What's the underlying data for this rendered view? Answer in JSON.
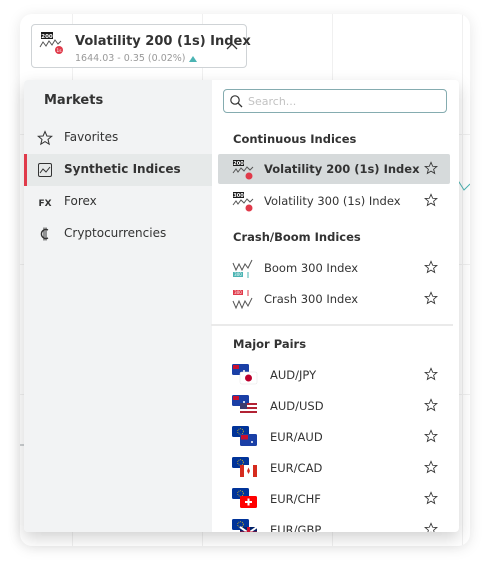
{
  "selector": {
    "symbol_label": "Volatility 200 (1s) Index",
    "price_text": "1644.03 - 0.35 (0.02%)",
    "change_direction": "up",
    "badge": "200",
    "expanded": true
  },
  "markets": {
    "title": "Markets",
    "categories": [
      {
        "label": "Favorites",
        "icon": "star-icon"
      },
      {
        "label": "Synthetic Indices",
        "icon": "synthetic-chart-icon",
        "active": true
      },
      {
        "label": "Forex",
        "icon": "fx-icon"
      },
      {
        "label": "Cryptocurrencies",
        "icon": "crypto-icon"
      }
    ]
  },
  "search": {
    "placeholder": "Search..."
  },
  "sections": [
    {
      "title": "Continuous Indices",
      "items": [
        {
          "label": "Volatility 200 (1s) Index",
          "badge": "200",
          "selected": true
        },
        {
          "label": "Volatility 300 (1s) Index",
          "badge": "300"
        }
      ]
    },
    {
      "title": "Crash/Boom Indices",
      "items": [
        {
          "label": "Boom 300 Index",
          "badge": "300"
        },
        {
          "label": "Crash 300 Index",
          "badge": "300"
        }
      ]
    },
    {
      "title": "Major Pairs",
      "items": [
        {
          "label": "AUD/JPY"
        },
        {
          "label": "AUD/USD"
        },
        {
          "label": "EUR/AUD"
        },
        {
          "label": "EUR/CAD"
        },
        {
          "label": "EUR/CHF"
        },
        {
          "label": "EUR/GBP"
        }
      ]
    }
  ],
  "colors": {
    "accent_red": "#e03a4a",
    "up_green": "#4bb4b3",
    "selected_row_bg": "#d6dadb",
    "left_panel_bg": "#f2f3f4"
  }
}
